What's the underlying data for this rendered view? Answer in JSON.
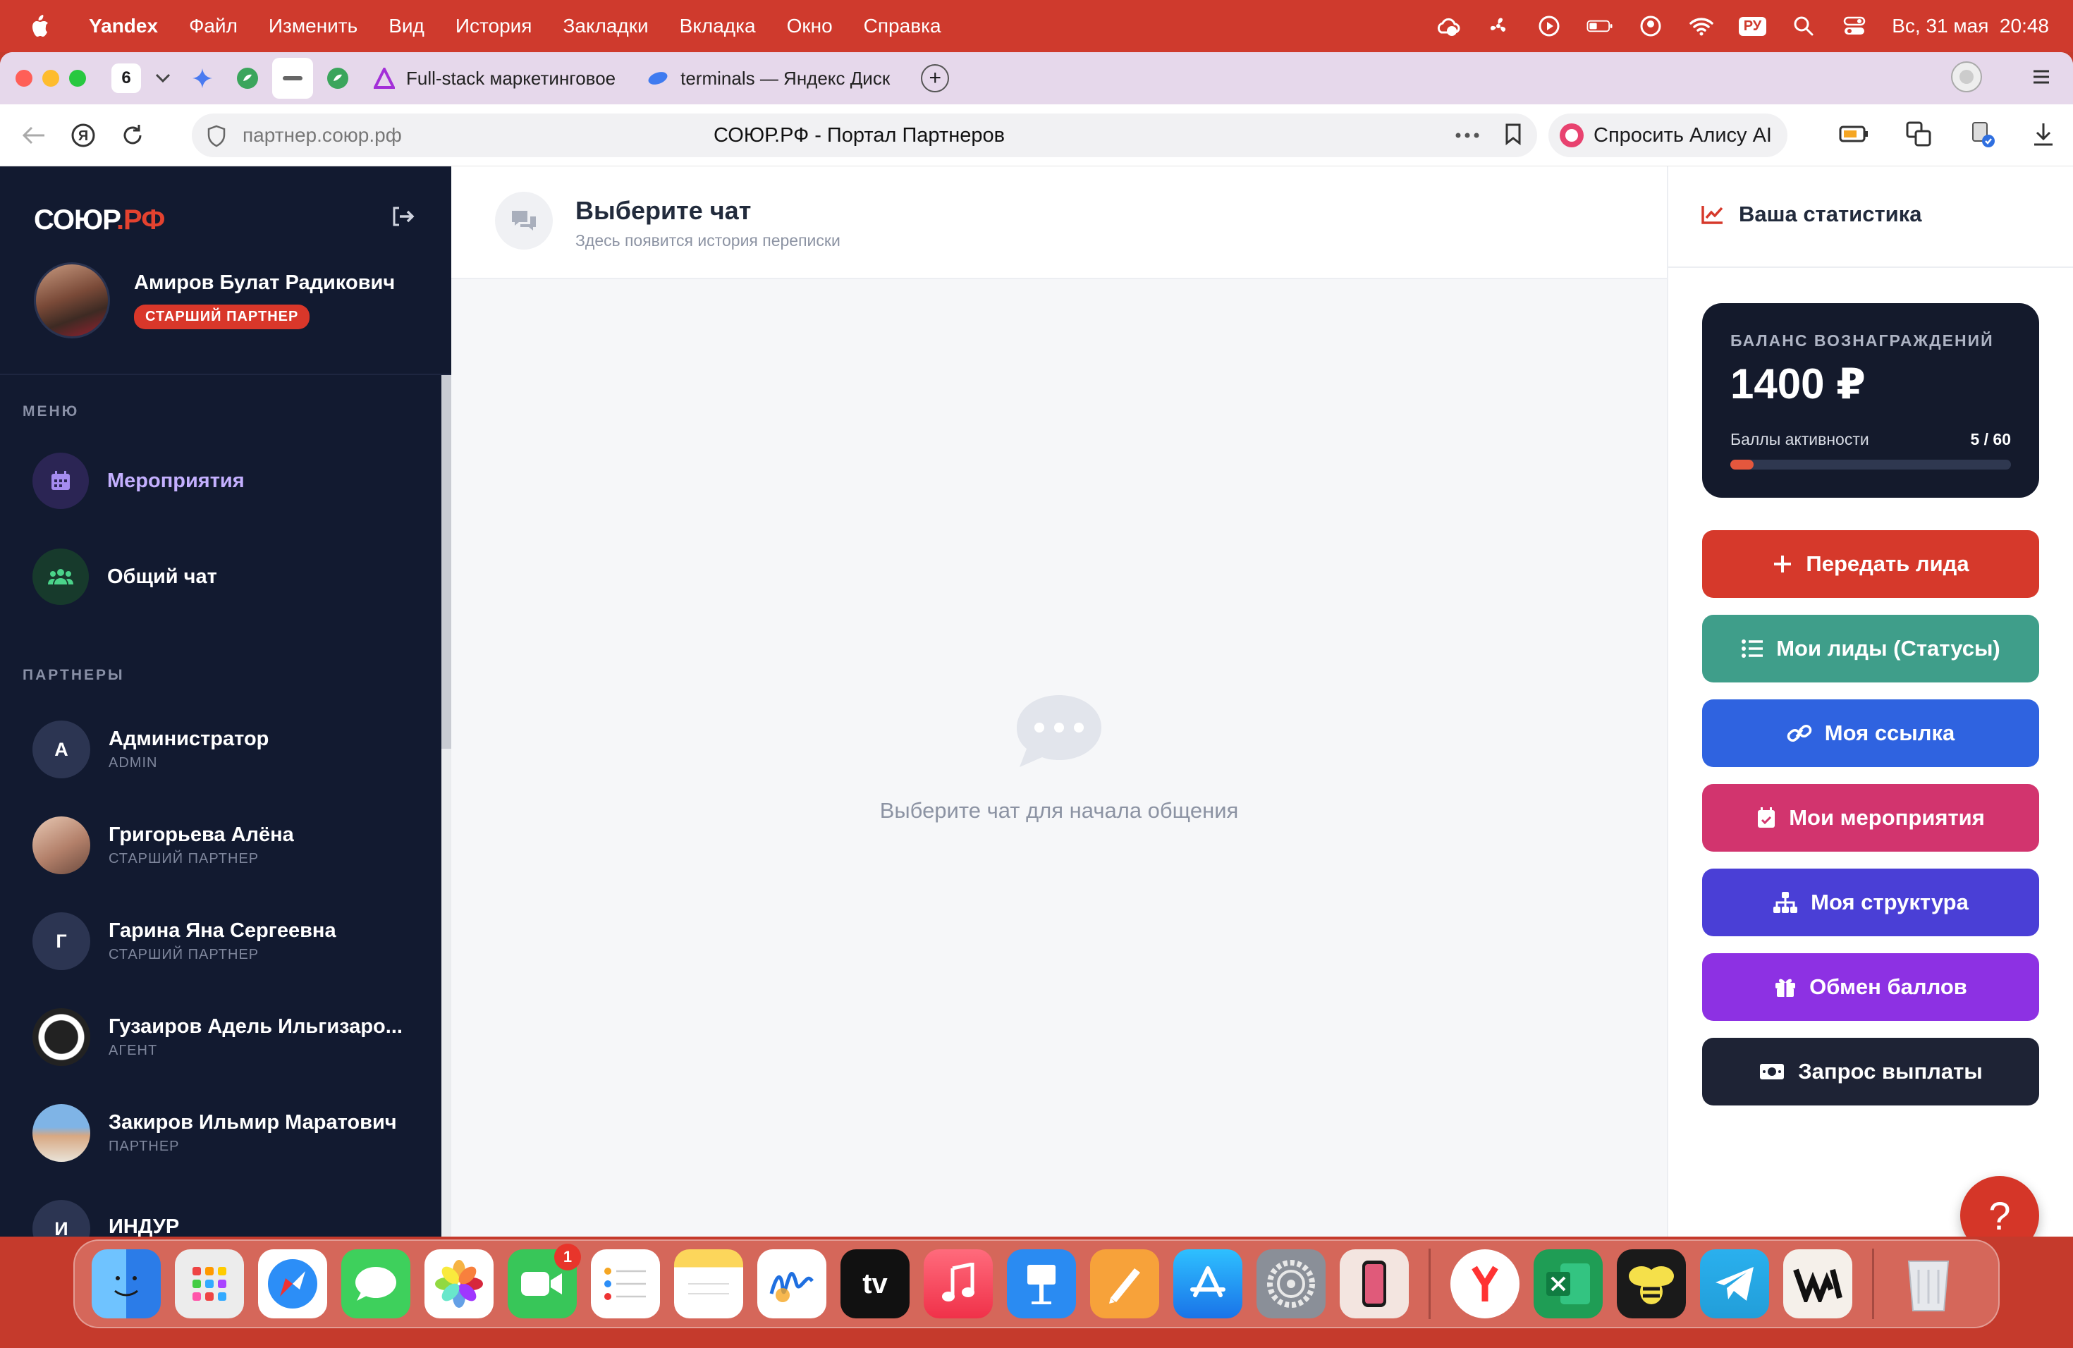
{
  "menubar": {
    "app": "Yandex",
    "items": [
      "Файл",
      "Изменить",
      "Вид",
      "История",
      "Закладки",
      "Вкладка",
      "Окно",
      "Справка"
    ],
    "lang": "РУ",
    "datetime": "Вс, 31 мая  20:48"
  },
  "browser": {
    "tab_count": "6",
    "tabs": [
      {
        "title": "Full-stack маркетинговое"
      },
      {
        "title": "terminals — Яндекс Диск"
      }
    ],
    "url": "партнер.союр.рф",
    "page_title": "СОЮР.РФ - Портал Партнеров",
    "alice_label": "Спросить Алису AI"
  },
  "sidebar": {
    "logo_main": "СОЮР",
    "logo_suffix": ".РФ",
    "user_name": "Амиров Булат Радикович",
    "user_role": "СТАРШИЙ ПАРТНЕР",
    "menu_title": "МЕНЮ",
    "menu": [
      {
        "label": "Мероприятия",
        "icon": "calendar-icon"
      },
      {
        "label": "Общий чат",
        "icon": "users-icon"
      }
    ],
    "partners_title": "ПАРТНЕРЫ",
    "partners": [
      {
        "name": "Администратор",
        "role": "ADMIN",
        "initial": "А"
      },
      {
        "name": "Григорьева Алёна",
        "role": "СТАРШИЙ ПАРТНЕР",
        "initial": ""
      },
      {
        "name": "Гарина Яна Сергеевна",
        "role": "СТАРШИЙ ПАРТНЕР",
        "initial": "Г"
      },
      {
        "name": "Гузаиров Адель Ильгизаро...",
        "role": "АГЕНТ",
        "initial": ""
      },
      {
        "name": "Закиров Ильмир Маратович",
        "role": "ПАРТНЕР",
        "initial": ""
      },
      {
        "name": "ИНДУР",
        "role": "",
        "initial": "И"
      }
    ]
  },
  "chat": {
    "title": "Выберите чат",
    "subtitle": "Здесь появится история переписки",
    "empty_text": "Выберите чат для начала общения"
  },
  "stats": {
    "title": "Ваша статистика",
    "balance_label": "БАЛАНС ВОЗНАГРАЖДЕНИЙ",
    "balance_value": "1400 ₽",
    "activity_label": "Баллы активности",
    "activity_value": "5 / 60",
    "activity_fraction": 0.083,
    "buttons": [
      {
        "label": "Передать лида",
        "color": "#d6392b"
      },
      {
        "label": "Мои лиды (Статусы)",
        "color": "#3f9e8a"
      },
      {
        "label": "Моя ссылка",
        "color": "#2f63e0"
      },
      {
        "label": "Мои мероприятия",
        "color": "#d2346e"
      },
      {
        "label": "Моя структура",
        "color": "#4a3fd6"
      },
      {
        "label": "Обмен баллов",
        "color": "#8d31e3"
      },
      {
        "label": "Запрос выплаты",
        "color": "#1e2335"
      }
    ],
    "help_label": "?"
  },
  "dock": {
    "facetime_badge": "1",
    "tv_label": "tv"
  },
  "colors": {
    "menubar": "#cf3a2d",
    "sidebar": "#121a30",
    "accent": "#e3422f"
  }
}
